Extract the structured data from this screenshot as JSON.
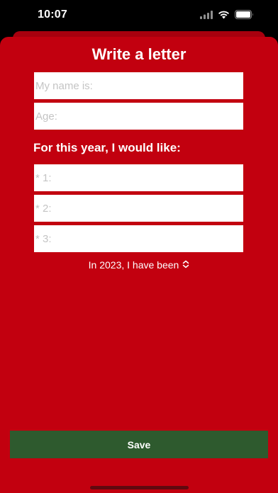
{
  "status_bar": {
    "time": "10:07",
    "icons": [
      "signal-icon",
      "wifi-icon",
      "battery-icon"
    ]
  },
  "form": {
    "title": "Write a letter",
    "name_placeholder": "My name is:",
    "age_placeholder": "Age:",
    "wishes_label": "For this year, I would like:",
    "wish_1_placeholder": "* 1:",
    "wish_2_placeholder": "* 2:",
    "wish_3_placeholder": "* 3:",
    "behavior_picker_label": "In 2023, I have been",
    "save_label": "Save"
  },
  "colors": {
    "background": "#c2000f",
    "save_button": "#2e5a2e"
  }
}
